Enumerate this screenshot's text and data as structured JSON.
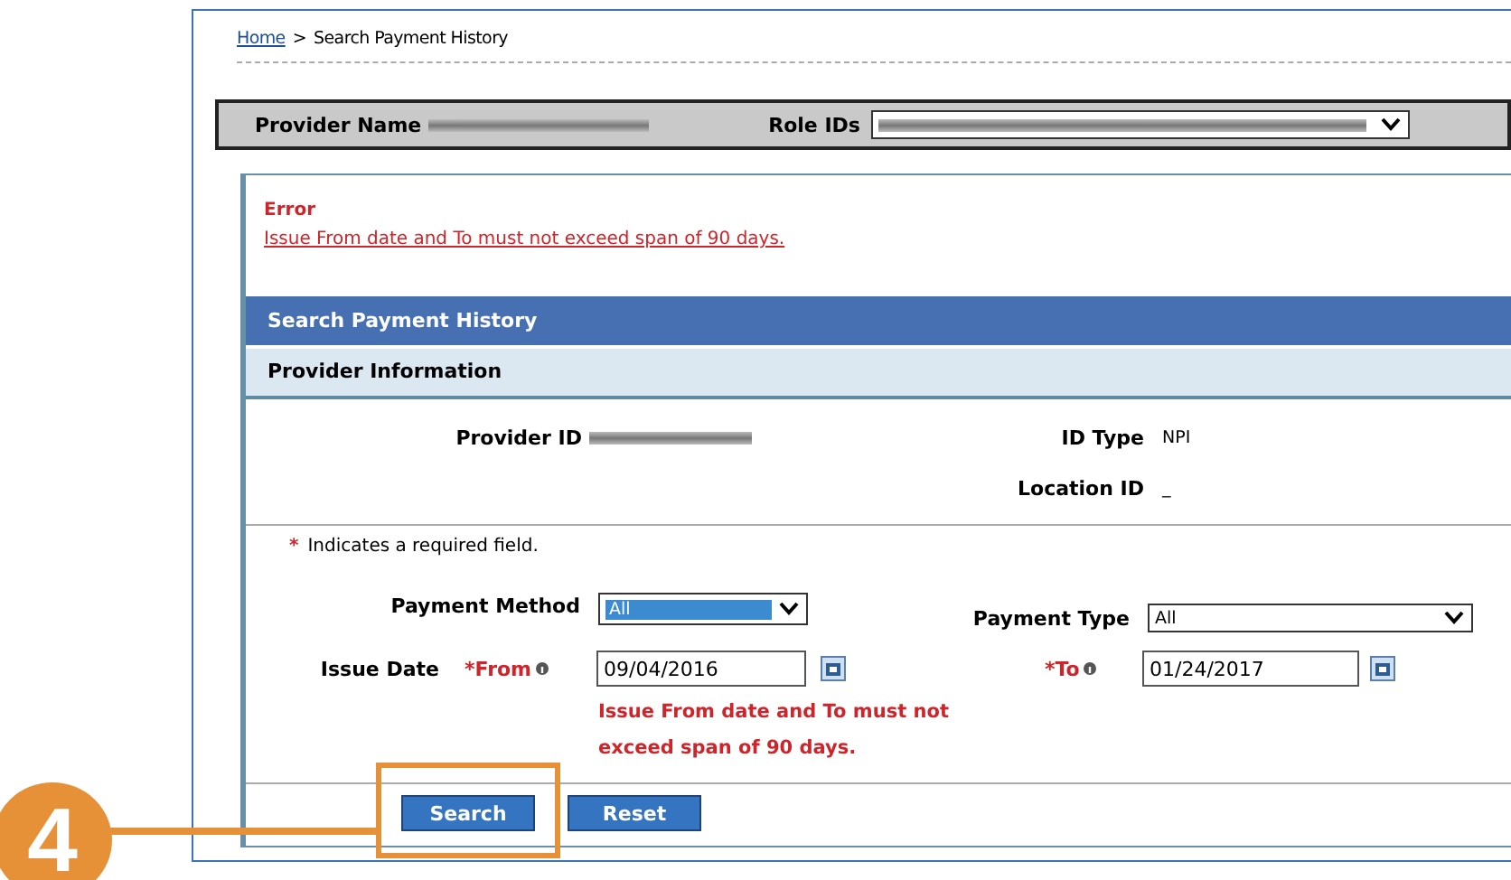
{
  "breadcrumb": {
    "link": "Home",
    "separator": ">",
    "current": "Search Payment History"
  },
  "provider_bar": {
    "provider_name_label": "Provider Name",
    "role_ids_label": "Role IDs"
  },
  "error": {
    "title": "Error",
    "message": "Issue From date and To must not exceed span of 90 days."
  },
  "panel_title": "Search Payment History",
  "section_title": "Provider Information",
  "provider_fields": [
    {
      "label": "Provider ID",
      "kind": "redacted"
    },
    {
      "label": "ID Type",
      "kind": "text",
      "value": "NPI"
    },
    {
      "label": "Location ID",
      "kind": "text",
      "value": "_"
    }
  ],
  "required_note": {
    "mark": "*",
    "text": "Indicates a required field."
  },
  "payment_method": {
    "label": "Payment Method",
    "value": "All",
    "focused": true
  },
  "payment_type": {
    "label": "Payment Type",
    "value": "All",
    "focused": false
  },
  "issue_date": {
    "label": "Issue Date",
    "from": {
      "label": "*From",
      "value": "09/04/2016"
    },
    "to": {
      "label": "*To",
      "value": "01/24/2017"
    },
    "error": "Issue From date and To must not exceed span of 90 days."
  },
  "buttons": [
    {
      "label": "Search",
      "highlighted": true
    },
    {
      "label": "Reset",
      "highlighted": false
    }
  ],
  "step": {
    "number": "4"
  }
}
